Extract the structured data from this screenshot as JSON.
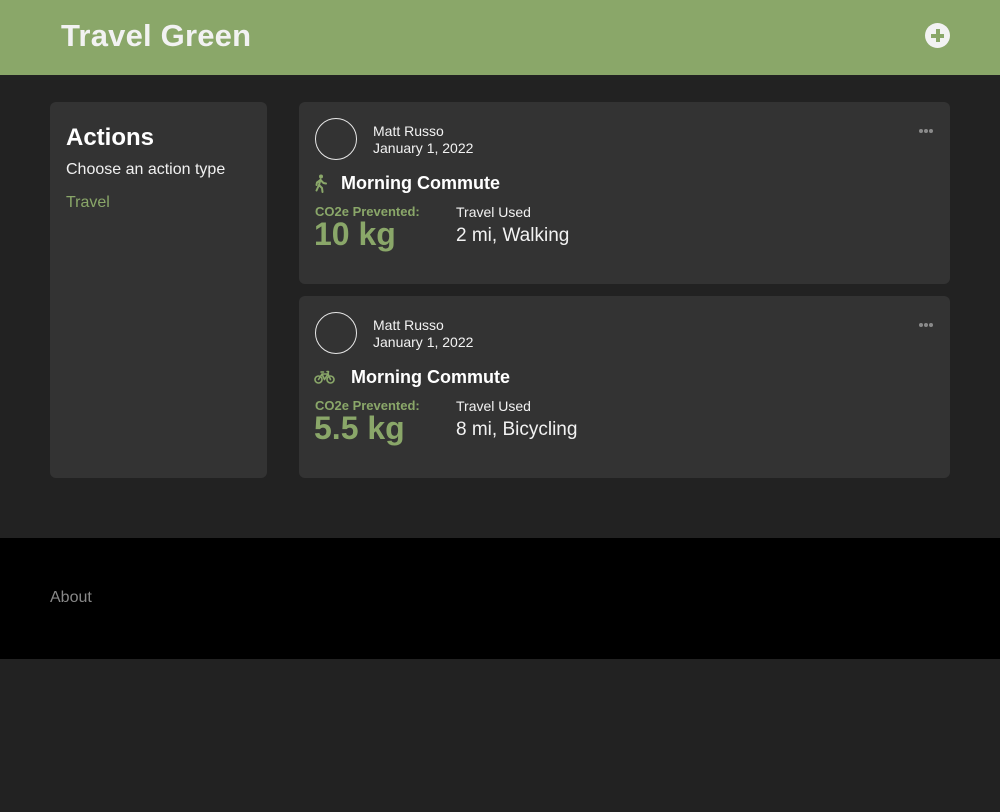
{
  "header": {
    "title": "Travel Green",
    "add_icon": "plus-circle-icon"
  },
  "sidebar": {
    "title": "Actions",
    "subtitle": "Choose an action type",
    "links": [
      "Travel"
    ]
  },
  "feed": [
    {
      "user": "Matt Russo",
      "date": "January 1, 2022",
      "icon": "walking-icon",
      "title": "Morning Commute",
      "co2_label": "CO2e Prevented:",
      "co2_value": "10 kg",
      "travel_label": "Travel Used",
      "travel_value": "2 mi, Walking"
    },
    {
      "user": "Matt Russo",
      "date": "January 1, 2022",
      "icon": "bicycle-icon",
      "title": "Morning Commute",
      "co2_label": "CO2e Prevented:",
      "co2_value": "5.5 kg",
      "travel_label": "Travel Used",
      "travel_value": "8 mi, Bicycling"
    }
  ],
  "footer": {
    "link": "About"
  },
  "colors": {
    "accent": "#8aa769",
    "background": "#222222",
    "card": "#333333",
    "footer": "#000000"
  }
}
